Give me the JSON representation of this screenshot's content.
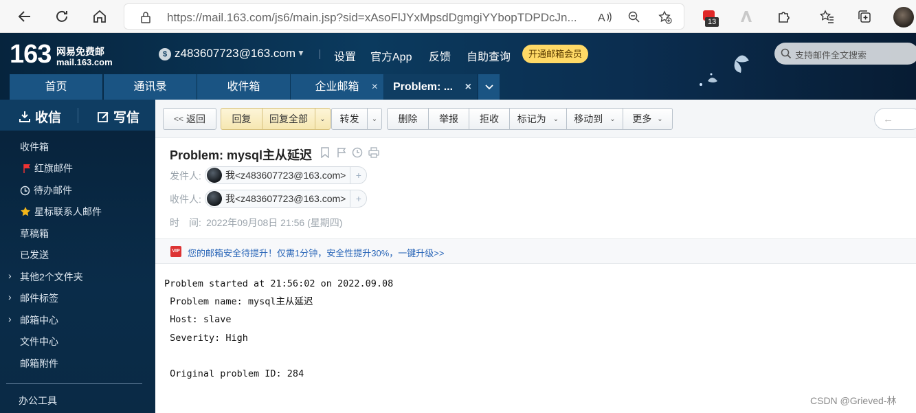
{
  "browser": {
    "url": "https://mail.163.com/js6/main.jsp?sid=xAsoFlJYxMpsdDgmgiYYbopTDPDcJn...",
    "extension_badge": "13"
  },
  "header": {
    "logo_number": "163",
    "logo_name": "网易免费邮",
    "logo_domain": "mail.163.com",
    "account_email": "z483607723@163.com",
    "links": [
      "设置",
      "官方App",
      "反馈",
      "自助查询"
    ],
    "vip_label": "开通邮箱会员",
    "search_placeholder": "支持邮件全文搜索"
  },
  "tabs": [
    {
      "label": "首页"
    },
    {
      "label": "通讯录"
    },
    {
      "label": "收件箱"
    },
    {
      "label": "企业邮箱"
    },
    {
      "label": "Problem: ..."
    }
  ],
  "sidebar": {
    "receive_label": "收信",
    "compose_label": "写信",
    "folders": [
      "收件箱",
      "红旗邮件",
      "待办邮件",
      "星标联系人邮件",
      "草稿箱",
      "已发送",
      "其他2个文件夹",
      "邮件标签",
      "邮箱中心",
      "文件中心",
      "邮箱附件",
      "办公工具"
    ]
  },
  "toolbar": {
    "back": "返回",
    "reply": "回复",
    "reply_all": "回复全部",
    "forward": "转发",
    "delete": "删除",
    "report": "举报",
    "reject": "拒收",
    "mark_as": "标记为",
    "move_to": "移动到",
    "more": "更多"
  },
  "email": {
    "subject": "Problem: mysql主从延迟",
    "from_label": "发件人:",
    "from": "我<z483607723@163.com>",
    "to_label": "收件人:",
    "to": "我<z483607723@163.com>",
    "time_label": "时　间:",
    "time": "2022年09月08日 21:56 (星期四)",
    "security_notice": "您的邮箱安全待提升！仅需1分钟，安全性提升30%，一键升级>>",
    "body": [
      "Problem started at 21:56:02 on 2022.09.08",
      " Problem name: mysql主从延迟",
      " Host: slave",
      " Severity: High",
      "",
      " Original problem ID: 284"
    ]
  },
  "watermark": "CSDN @Grieved-林"
}
